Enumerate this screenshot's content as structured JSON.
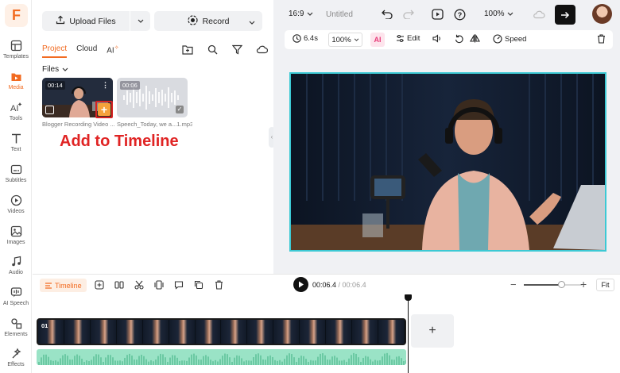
{
  "app": {
    "logo_letter": "F",
    "accent_color": "#f26b21"
  },
  "sidebar": {
    "items": [
      {
        "label": "Templates",
        "icon": "templates-icon"
      },
      {
        "label": "Media",
        "icon": "media-icon",
        "active": true
      },
      {
        "label": "Tools",
        "icon": "ai-tools-icon"
      },
      {
        "label": "Text",
        "icon": "text-icon"
      },
      {
        "label": "Subtitles",
        "icon": "subtitles-icon"
      },
      {
        "label": "Videos",
        "icon": "videos-icon"
      },
      {
        "label": "Images",
        "icon": "images-icon"
      },
      {
        "label": "Audio",
        "icon": "audio-icon"
      },
      {
        "label": "AI Speech",
        "icon": "ai-speech-icon"
      },
      {
        "label": "Elements",
        "icon": "elements-icon"
      },
      {
        "label": "Effects",
        "icon": "effects-icon"
      }
    ]
  },
  "media_panel": {
    "upload_label": "Upload Files",
    "record_label": "Record",
    "tabs": [
      {
        "label": "Project",
        "active": true
      },
      {
        "label": "Cloud"
      },
      {
        "label": "AI"
      }
    ],
    "files_label": "Files",
    "files": [
      {
        "duration": "00:14",
        "name": "Blogger Recording Video ...",
        "type": "video"
      },
      {
        "duration": "00:06",
        "name": "Speech_Today, we a...1.mp3",
        "type": "audio"
      }
    ],
    "annotation": "Add to Timeline",
    "annotation_color": "#e02424"
  },
  "preview": {
    "aspect_ratio": "16:9",
    "project_title": "Untitled",
    "zoom": "100%",
    "edit_bar": {
      "duration": "6.4s",
      "scale": "100%",
      "ai_label": "AI",
      "edit_label": "Edit",
      "speed_label": "Speed"
    },
    "frame_border_color": "#3cc9d4"
  },
  "timeline": {
    "label": "Timeline",
    "current_time": "00:06.4",
    "total_time": "/ 00:06.4",
    "zoom_level": 0.65,
    "fit_label": "Fit",
    "track_number": "01",
    "add_clip_label": "+",
    "audio_track_color": "#9ae3c6"
  }
}
